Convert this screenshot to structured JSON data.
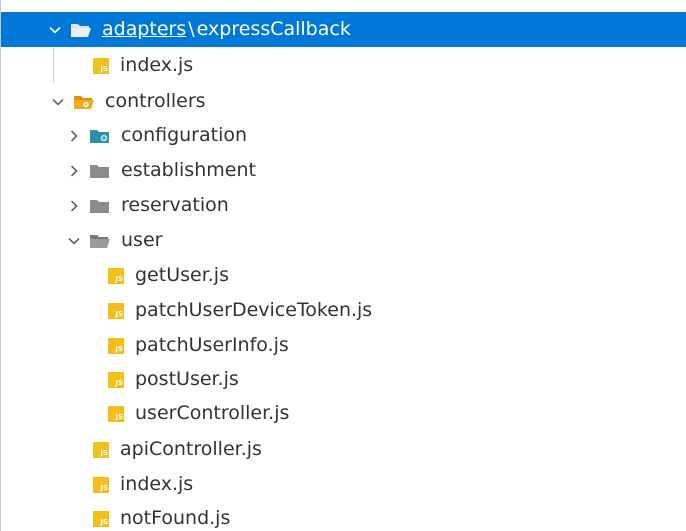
{
  "colors": {
    "selection_bg": "#0078d7",
    "text": "#333333",
    "folder_gray": "#8c8c8c",
    "folder_orange": "#f0ac1f",
    "folder_teal": "#2e8fa8",
    "js_yellow": "#f4bf1a"
  },
  "selected_row": {
    "segment_link": "adapters",
    "separator": "\\",
    "segment_rest": "expressCallback"
  },
  "rows": [
    {
      "label": "index.js",
      "icon": "js-file-icon"
    },
    {
      "label": "controllers",
      "icon": "folder-open-orange-icon"
    },
    {
      "label": "configuration",
      "icon": "folder-config-icon"
    },
    {
      "label": "establishment",
      "icon": "folder-icon"
    },
    {
      "label": "reservation",
      "icon": "folder-icon"
    },
    {
      "label": "user",
      "icon": "folder-open-icon"
    },
    {
      "label": "getUser.js",
      "icon": "js-file-icon"
    },
    {
      "label": "patchUserDeviceToken.js",
      "icon": "js-file-icon"
    },
    {
      "label": "patchUserInfo.js",
      "icon": "js-file-icon"
    },
    {
      "label": "postUser.js",
      "icon": "js-file-icon"
    },
    {
      "label": "userController.js",
      "icon": "js-file-icon"
    },
    {
      "label": "apiController.js",
      "icon": "js-file-icon"
    },
    {
      "label": "index.js",
      "icon": "js-file-icon"
    },
    {
      "label": "notFound.js",
      "icon": "js-file-icon"
    }
  ],
  "icon_text": {
    "js": "JS"
  }
}
